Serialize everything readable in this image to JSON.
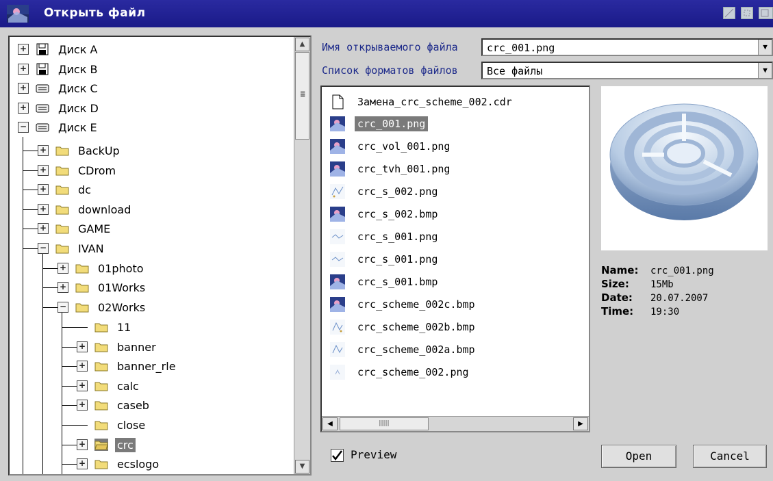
{
  "window": {
    "title": "Открыть файл"
  },
  "tree": {
    "nodes": [
      {
        "label": "Диск A",
        "icon": "floppy-icon"
      },
      {
        "label": "Диск B",
        "icon": "floppy-icon"
      },
      {
        "label": "Диск C",
        "icon": "harddisk-icon"
      },
      {
        "label": "Диск D",
        "icon": "harddisk-icon"
      },
      {
        "label": "Диск E",
        "icon": "harddisk-icon"
      },
      {
        "label": "BackUp",
        "icon": "folder-icon"
      },
      {
        "label": "CDrom",
        "icon": "folder-icon"
      },
      {
        "label": "dc",
        "icon": "folder-icon"
      },
      {
        "label": "download",
        "icon": "folder-icon"
      },
      {
        "label": "GAME",
        "icon": "folder-icon"
      },
      {
        "label": "IVAN",
        "icon": "folder-icon"
      },
      {
        "label": "01photo",
        "icon": "folder-icon"
      },
      {
        "label": "01Works",
        "icon": "folder-icon"
      },
      {
        "label": "02Works",
        "icon": "folder-icon"
      },
      {
        "label": "11",
        "icon": "folder-icon"
      },
      {
        "label": "banner",
        "icon": "folder-icon"
      },
      {
        "label": "banner_rle",
        "icon": "folder-icon"
      },
      {
        "label": "calc",
        "icon": "folder-icon"
      },
      {
        "label": "caseb",
        "icon": "folder-icon"
      },
      {
        "label": "close",
        "icon": "folder-icon"
      },
      {
        "label": "crc",
        "icon": "folder-open-icon",
        "selected": true
      },
      {
        "label": "ecslogo",
        "icon": "folder-icon"
      }
    ]
  },
  "filename": {
    "label": "Имя открываемого файла",
    "value": "crc_001.png"
  },
  "filetype": {
    "label": "Список форматов файлов",
    "value": "Все файлы"
  },
  "files": [
    {
      "name": "Замена_crc_scheme_002.cdr",
      "icon": "document-icon"
    },
    {
      "name": "crc_001.png",
      "icon": "image-thumb-icon",
      "selected": true
    },
    {
      "name": "crc_vol_001.png",
      "icon": "image-thumb-icon"
    },
    {
      "name": "crc_tvh_001.png",
      "icon": "image-thumb-icon"
    },
    {
      "name": "crc_s_002.png",
      "icon": "scheme-thumb-icon"
    },
    {
      "name": "crc_s_002.bmp",
      "icon": "image-thumb-icon"
    },
    {
      "name": "crc_s_001.png",
      "icon": "scheme-thumb-icon"
    },
    {
      "name": "crc_s_001.png",
      "icon": "scheme-thumb-icon"
    },
    {
      "name": "crc_s_001.bmp",
      "icon": "image-thumb-icon"
    },
    {
      "name": "crc_scheme_002c.bmp",
      "icon": "image-thumb-icon"
    },
    {
      "name": "crc_scheme_002b.bmp",
      "icon": "scheme-thumb-icon"
    },
    {
      "name": "crc_scheme_002a.bmp",
      "icon": "scheme-thumb-icon"
    },
    {
      "name": "crc_scheme_002.png",
      "icon": "scheme-thumb-icon"
    }
  ],
  "info": {
    "name_label": "Name:",
    "name_value": "crc_001.png",
    "size_label": "Size:",
    "size_value": "15Mb",
    "date_label": "Date:",
    "date_value": "20.07.2007",
    "time_label": "Time:",
    "time_value": "19:30"
  },
  "preview": {
    "checked": true,
    "label": "Preview"
  },
  "buttons": {
    "open": "Open",
    "cancel": "Cancel"
  },
  "colors": {
    "titlebar": "#1a1a88",
    "label_text": "#1d2a8a",
    "selection": "#7a7a7a",
    "background": "#d0d0d0"
  }
}
